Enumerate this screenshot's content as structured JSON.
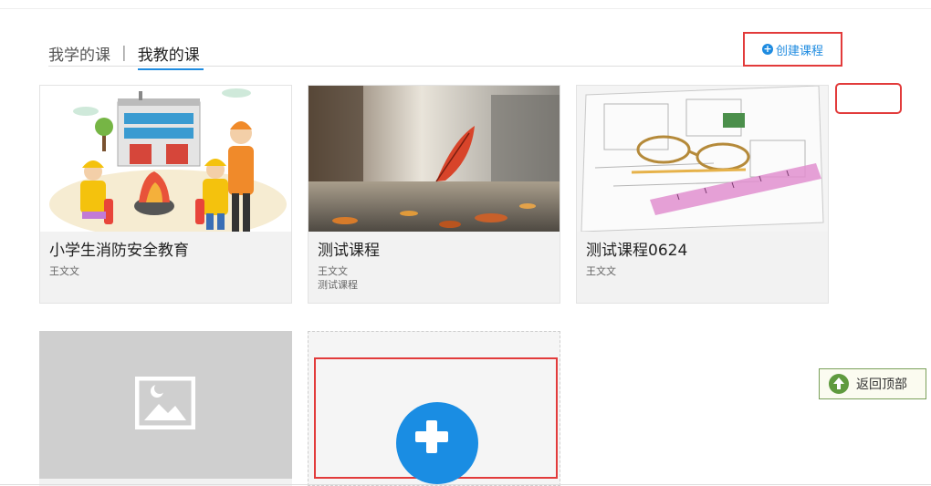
{
  "tabs": {
    "learn": "我学的课",
    "separator": "|",
    "teach": "我教的课"
  },
  "create_button": {
    "label": "创建课程"
  },
  "courses": [
    {
      "title": "小学生消防安全教育",
      "teacher": "王文文",
      "desc": ""
    },
    {
      "title": "测试课程",
      "teacher": "王文文",
      "desc": "测试课程"
    },
    {
      "title": "测试课程0624",
      "teacher": "王文文",
      "desc": ""
    }
  ],
  "back_to_top": {
    "label": "返回顶部"
  },
  "colors": {
    "accent": "#1e8be0",
    "highlight_red": "#e23b3b",
    "card_bg": "#f2f2f2",
    "back_top_green": "#5f9a3e"
  },
  "icons": {
    "create": "plus-circle-icon",
    "add": "plus-icon",
    "placeholder": "image-placeholder-icon",
    "back_top": "arrow-up-icon"
  }
}
